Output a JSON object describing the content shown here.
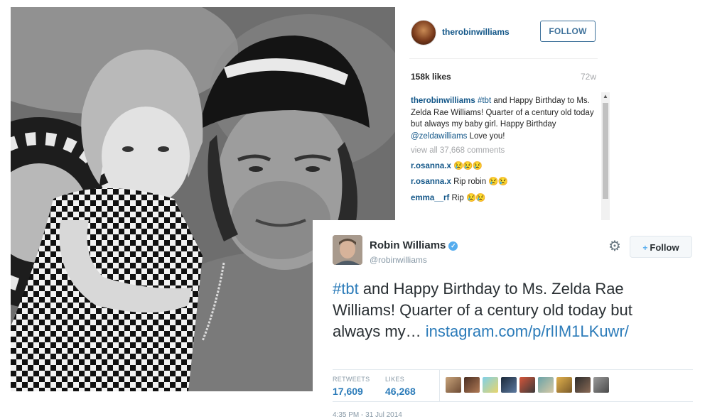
{
  "instagram": {
    "username": "therobinwilliams",
    "follow_label": "FOLLOW",
    "likes": "158k likes",
    "age": "72w",
    "caption": {
      "username": "therobinwilliams",
      "hashtag": "#tbt",
      "text_a": "and Happy Birthday to Ms. Zelda Rae Williams! Quarter of a century old today but always my baby girl. Happy Birthday",
      "mention": "@zeldawilliams",
      "text_b": "Love you!"
    },
    "view_all": "view all 37,668 comments",
    "comments": [
      {
        "user": "r.osanna.x",
        "text": "",
        "emoji": "😢😢😢"
      },
      {
        "user": "r.osanna.x",
        "text": "Rip robin",
        "emoji": "😢😢"
      },
      {
        "user": "emma__rf",
        "text": "Rip",
        "emoji": "😢😢"
      }
    ]
  },
  "twitter": {
    "name": "Robin Williams",
    "verified_glyph": "✓",
    "handle": "@robinwilliams",
    "follow_label": "Follow",
    "follow_icon": "+",
    "gear_icon": "⚙",
    "tweet": {
      "hashtag": "#tbt",
      "text": " and Happy Birthday to Ms. Zelda Rae Williams!    Quarter of a century old today but always my… ",
      "link": "instagram.com/p/rlIM1LKuwr/"
    },
    "retweets_label": "RETWEETS",
    "retweets": "17,609",
    "likes_label": "LIKES",
    "likes": "46,268",
    "timestamp": "4:35 PM - 31 Jul 2014"
  },
  "colors": {
    "ig_link": "#125688",
    "ig_follow": "#3f729b",
    "tw_link": "#2b7bb9",
    "tw_blue": "#55acee"
  }
}
